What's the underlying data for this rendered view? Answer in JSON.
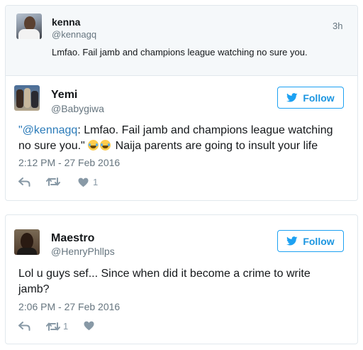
{
  "quoted_tweet": {
    "name": "kenna",
    "handle": "@kennagq",
    "time": "3h",
    "text": "Lmfao. Fail jamb and champions league watching no sure you."
  },
  "tweets": [
    {
      "name": "Yemi",
      "handle": "@Babygiwa",
      "follow_label": "Follow",
      "text_link": "\"@kennagq",
      "text_part1": ": Lmfao. Fail jamb and champions league watching",
      "text_part2": "no sure you.\"",
      "text_part3": " Naija parents are going to insult your life",
      "emoji": [
        "face-with-tears-of-joy",
        "face-with-tears-of-joy"
      ],
      "date": "2:12 PM - 27 Feb 2016",
      "actions": {
        "reply": "",
        "retweet": "",
        "like": "1"
      }
    },
    {
      "name": "Maestro",
      "handle": "@HenryPhllps",
      "follow_label": "Follow",
      "text_line1": "Lol u guys sef... Since when did it become a crime to write",
      "text_line2": "jamb?",
      "date": "2:06 PM - 27 Feb 2016",
      "actions": {
        "reply": "",
        "retweet": "1",
        "like": ""
      }
    }
  ],
  "colors": {
    "accent": "#1da1f2",
    "link": "#2b7bb9",
    "muted": "#66757f",
    "icon": "#8899a6",
    "border": "#e1e8ed"
  }
}
